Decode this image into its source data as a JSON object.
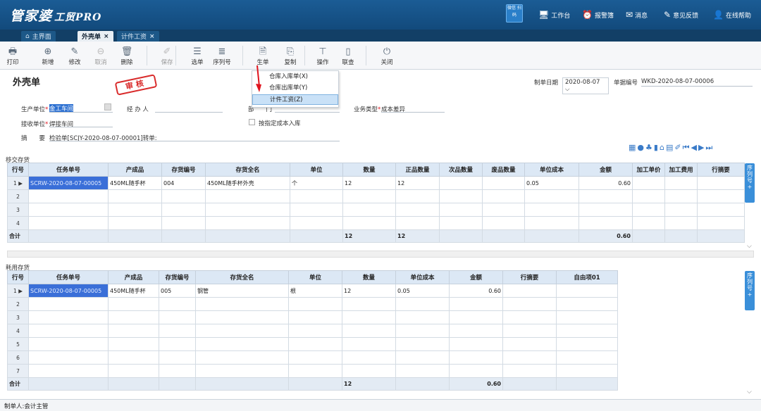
{
  "app": {
    "logo": "管家婆",
    "logo_sub": "工贸PRO",
    "qr_label": "微信\n扫码"
  },
  "topnav": [
    {
      "label": "工作台",
      "icon": "monitor-icon"
    },
    {
      "label": "报警簿",
      "icon": "alarm-icon"
    },
    {
      "label": "消息",
      "icon": "mail-icon"
    },
    {
      "label": "意见反馈",
      "icon": "edit-icon"
    },
    {
      "label": "在线帮助",
      "icon": "user-icon"
    }
  ],
  "tabs": [
    {
      "label": "主界面",
      "active": false
    },
    {
      "label": "外壳单",
      "active": true
    },
    {
      "label": "计件工资",
      "active": false
    }
  ],
  "toolbar": [
    {
      "label": "打印",
      "icon": "printer-icon"
    },
    {
      "label": "新增",
      "icon": "plus-icon"
    },
    {
      "label": "修改",
      "icon": "edit-icon"
    },
    {
      "label": "取消",
      "icon": "cancel-icon",
      "dim": true
    },
    {
      "label": "删除",
      "icon": "trash-icon"
    },
    {
      "label": "保存",
      "icon": "pen-icon",
      "dim": true
    },
    {
      "label": "选单",
      "icon": "select-icon"
    },
    {
      "label": "序列号",
      "icon": "list-icon"
    },
    {
      "label": "生单",
      "icon": "doc-icon"
    },
    {
      "label": "复制",
      "icon": "copy-icon"
    },
    {
      "label": "操作",
      "icon": "operate-icon"
    },
    {
      "label": "联查",
      "icon": "link-icon"
    },
    {
      "label": "关闭",
      "icon": "power-icon"
    }
  ],
  "dropdown": [
    "仓库入库单(X)",
    "仓库出库单(Y)",
    "计件工资(Z)"
  ],
  "form": {
    "title": "外壳单",
    "stamp": "审核",
    "date_label": "制单日期",
    "date_value": "2020-08-07",
    "bill_label": "单据编号",
    "bill_value": "WKD-2020-08-07-00006",
    "prod_unit_label": "生产单位",
    "prod_unit_value": "金工车间",
    "handler_label": "经 办 人",
    "dept_label": "部　　门",
    "biz_type_label": "业务类型",
    "biz_type_value": "成本差异",
    "recv_unit_label": "接收单位",
    "recv_unit_value": "焊接车间",
    "checkbox_label": "按指定成本入库",
    "memo_label": "摘　　要",
    "memo_value": "检验单[SCJY-2020-08-07-00001]转单:"
  },
  "table1": {
    "section": "移交存货",
    "headers": [
      "行号",
      "任务单号",
      "产成品",
      "存货编号",
      "存货全名",
      "单位",
      "数量",
      "正品数量",
      "次品数量",
      "废品数量",
      "单位成本",
      "金额",
      "加工单价",
      "加工费用",
      "行摘要"
    ],
    "rows": [
      [
        "1",
        "SCRW-2020-08-07-00005",
        "450ML随手杯",
        "004",
        "450ML随手杯外壳",
        "个",
        "12",
        "12",
        "",
        "",
        "0.05",
        "0.60",
        "",
        "",
        ""
      ],
      [
        "2"
      ],
      [
        "3"
      ],
      [
        "4"
      ]
    ],
    "sum": [
      "合计",
      "",
      "",
      "",
      "",
      "",
      "12",
      "12",
      "",
      "",
      "",
      "0.60",
      "",
      "",
      ""
    ]
  },
  "table2": {
    "section": "耗用存货",
    "headers": [
      "行号",
      "任务单号",
      "产成品",
      "存货编号",
      "存货全名",
      "单位",
      "数量",
      "单位成本",
      "金额",
      "行摘要",
      "自由项01"
    ],
    "rows": [
      [
        "1",
        "SCRW-2020-08-07-00005",
        "450ML随手杯",
        "005",
        "钢管",
        "根",
        "12",
        "0.05",
        "0.60",
        "",
        ""
      ],
      [
        "2"
      ],
      [
        "3"
      ],
      [
        "4"
      ],
      [
        "5"
      ],
      [
        "6"
      ],
      [
        "7"
      ]
    ],
    "sum": [
      "合计",
      "",
      "",
      "",
      "",
      "",
      "12",
      "",
      "0.60",
      "",
      ""
    ]
  },
  "side_label": "序列号",
  "footer": {
    "label": "制单人:",
    "value": "会计主管"
  },
  "colors": {
    "topbar": "#1b5c95",
    "header": "#dce8f5",
    "accent": "#3a8fd9"
  }
}
